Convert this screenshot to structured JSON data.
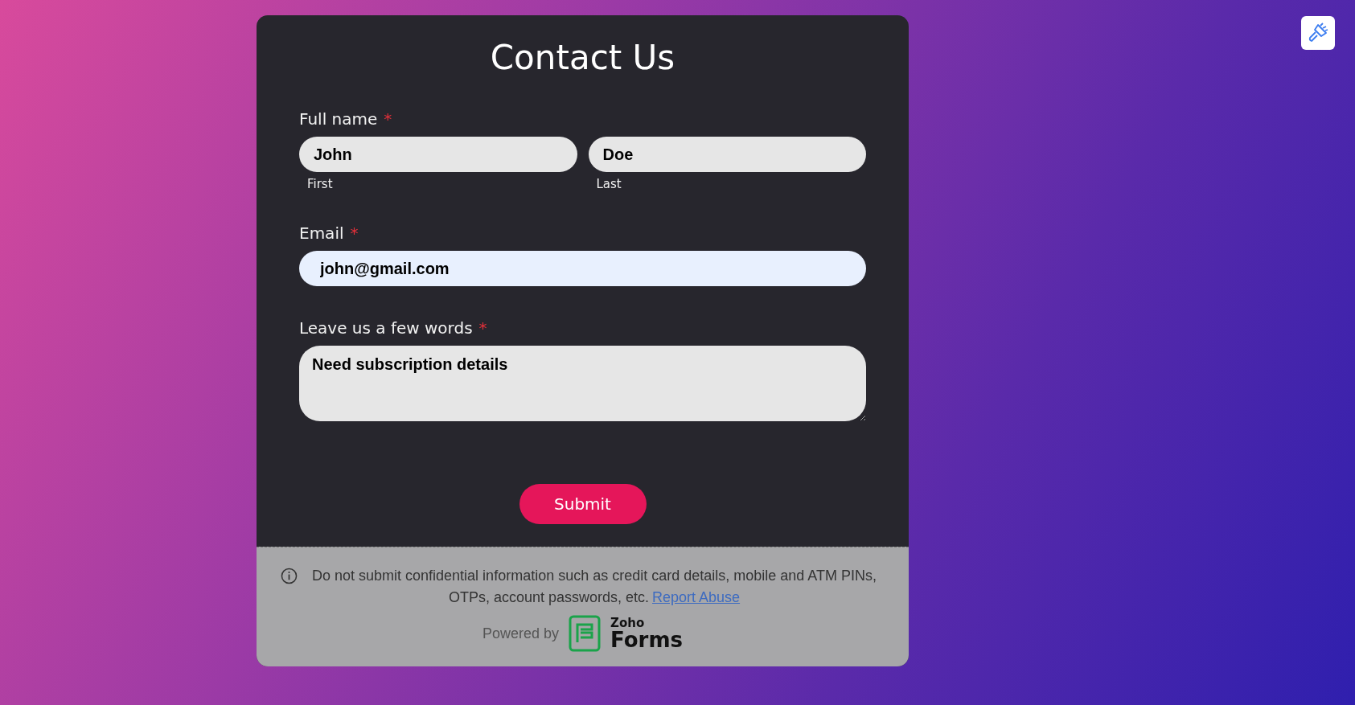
{
  "title": "Contact Us",
  "fields": [
    {
      "kind": "name",
      "label": "Full name",
      "required_mark": "*",
      "parts": [
        {
          "value": "John",
          "sublabel": "First",
          "focused": false
        },
        {
          "value": "Doe",
          "sublabel": "Last",
          "focused": false
        }
      ]
    },
    {
      "kind": "single",
      "label": "Email",
      "required_mark": "*",
      "parts": [
        {
          "value": "john@gmail.com",
          "focused": true
        }
      ]
    },
    {
      "kind": "multiline",
      "label": "Leave us a few words",
      "required_mark": "*",
      "parts": [
        {
          "value": "Need subscription details",
          "focused": false
        }
      ]
    }
  ],
  "submit": "Submit",
  "footer": {
    "notice": "Do not submit confidential information such as credit card details, mobile and ATM PINs, OTPs, account passwords, etc.",
    "link": "Report Abuse",
    "powered_by": "Powered by",
    "brand_small": "Zoho",
    "brand_large": "Forms"
  }
}
